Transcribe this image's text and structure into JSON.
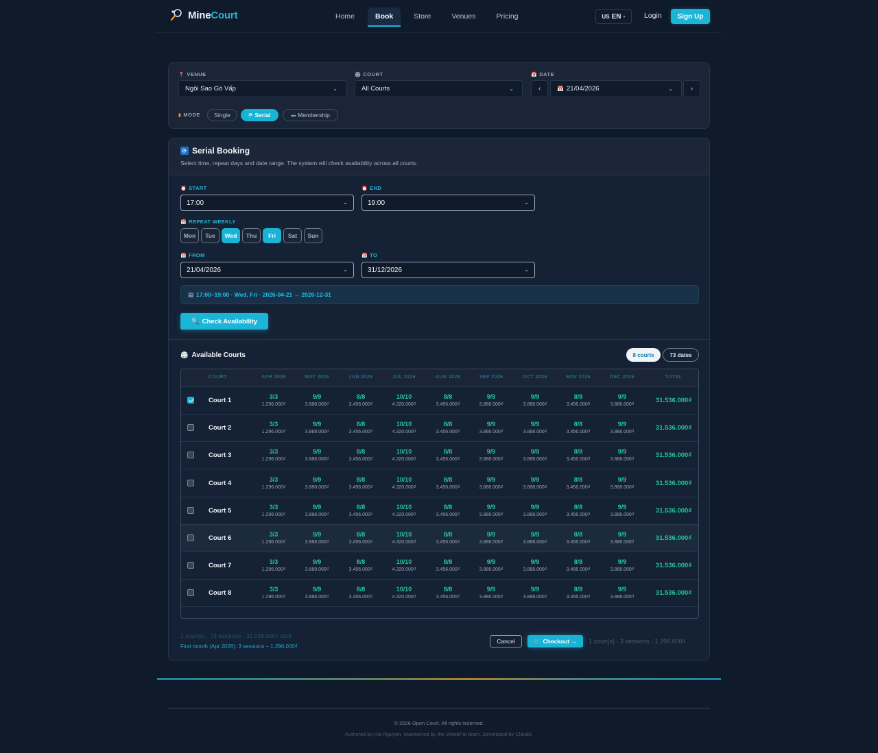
{
  "brand": {
    "name_a": "Mine",
    "name_b": "Court"
  },
  "nav": {
    "items": [
      "Home",
      "Book",
      "Store",
      "Venues",
      "Pricing"
    ],
    "active": 1
  },
  "lang": {
    "code": "US",
    "label": "EN"
  },
  "auth": {
    "login": "Login",
    "signup": "Sign Up"
  },
  "filters": {
    "venue_label": "VENUE",
    "venue_value": "Ngôi Sao Gò Vấp",
    "court_label": "COURT",
    "court_value": "All Courts",
    "date_label": "DATE",
    "date_value": "21/04/2026",
    "mode_label": "MODE",
    "modes": [
      "Single",
      "Serial",
      "Membership"
    ]
  },
  "serial": {
    "title": "Serial Booking",
    "subtitle": "Select time, repeat days and date range. The system will check availability across all courts.",
    "start_label": "START",
    "start_value": "17:00",
    "end_label": "END",
    "end_value": "19:00",
    "repeat_label": "REPEAT WEEKLY",
    "days": [
      "Mon",
      "Tue",
      "Wed",
      "Thu",
      "Fri",
      "Sat",
      "Sun"
    ],
    "days_on": [
      false,
      false,
      true,
      false,
      true,
      false,
      false
    ],
    "from_label": "FROM",
    "from_value": "21/04/2026",
    "to_label": "TO",
    "to_value": "31/12/2026",
    "summary": "17:00–19:00 · Wed, Fri · 2026-04-21 → 2026-12-31",
    "check_label": "Check Availability"
  },
  "available": {
    "title": "Available Courts",
    "courts_badge": "8 courts",
    "dates_badge": "73 dates",
    "columns": [
      "COURT",
      "APR 2026",
      "MAY 2026",
      "JUN 2026",
      "JUL 2026",
      "AUG 2026",
      "SEP 2026",
      "OCT 2026",
      "NOV 2026",
      "DEC 2026",
      "TOTAL"
    ],
    "months": [
      {
        "r": "3/3",
        "p": "1.296.000₫"
      },
      {
        "r": "9/9",
        "p": "3.888.000₫"
      },
      {
        "r": "8/8",
        "p": "3.456.000₫"
      },
      {
        "r": "10/10",
        "p": "4.320.000₫"
      },
      {
        "r": "8/8",
        "p": "3.456.000₫"
      },
      {
        "r": "9/9",
        "p": "3.888.000₫"
      },
      {
        "r": "9/9",
        "p": "3.888.000₫"
      },
      {
        "r": "8/8",
        "p": "3.456.000₫"
      },
      {
        "r": "9/9",
        "p": "3.888.000₫"
      }
    ],
    "rows": [
      {
        "name": "Court 1",
        "checked": true,
        "total": "31.536.000₫"
      },
      {
        "name": "Court 2",
        "checked": false,
        "total": "31.536.000₫"
      },
      {
        "name": "Court 3",
        "checked": false,
        "total": "31.536.000₫"
      },
      {
        "name": "Court 4",
        "checked": false,
        "total": "31.536.000₫"
      },
      {
        "name": "Court 5",
        "checked": false,
        "total": "31.536.000₫"
      },
      {
        "name": "Court 6",
        "checked": false,
        "total": "31.536.000₫"
      },
      {
        "name": "Court 7",
        "checked": false,
        "total": "31.536.000₫"
      },
      {
        "name": "Court 8",
        "checked": false,
        "total": "31.536.000₫"
      }
    ],
    "highlight_row": 5
  },
  "footer_summary": {
    "line1": "1 court(s) · 73 sessions · 31.536.000₫ total",
    "line2": "First month (Apr 2026): 3 sessions – 1.296.000₫",
    "cancel": "Cancel",
    "checkout": "Checkout →",
    "cart": "1 court(s) · 3 sessions · 1.296.000₫"
  },
  "site_footer": {
    "copyright": "© 2026 Open Court. All rights reserved.",
    "authored": "Authored by Hai Nguyen, Maintained by the WeebPal team, Developed by Claude."
  },
  "colors": {
    "accent": "#1ab5d7",
    "bg": "#0f1a2b",
    "success": "#22c79a"
  }
}
